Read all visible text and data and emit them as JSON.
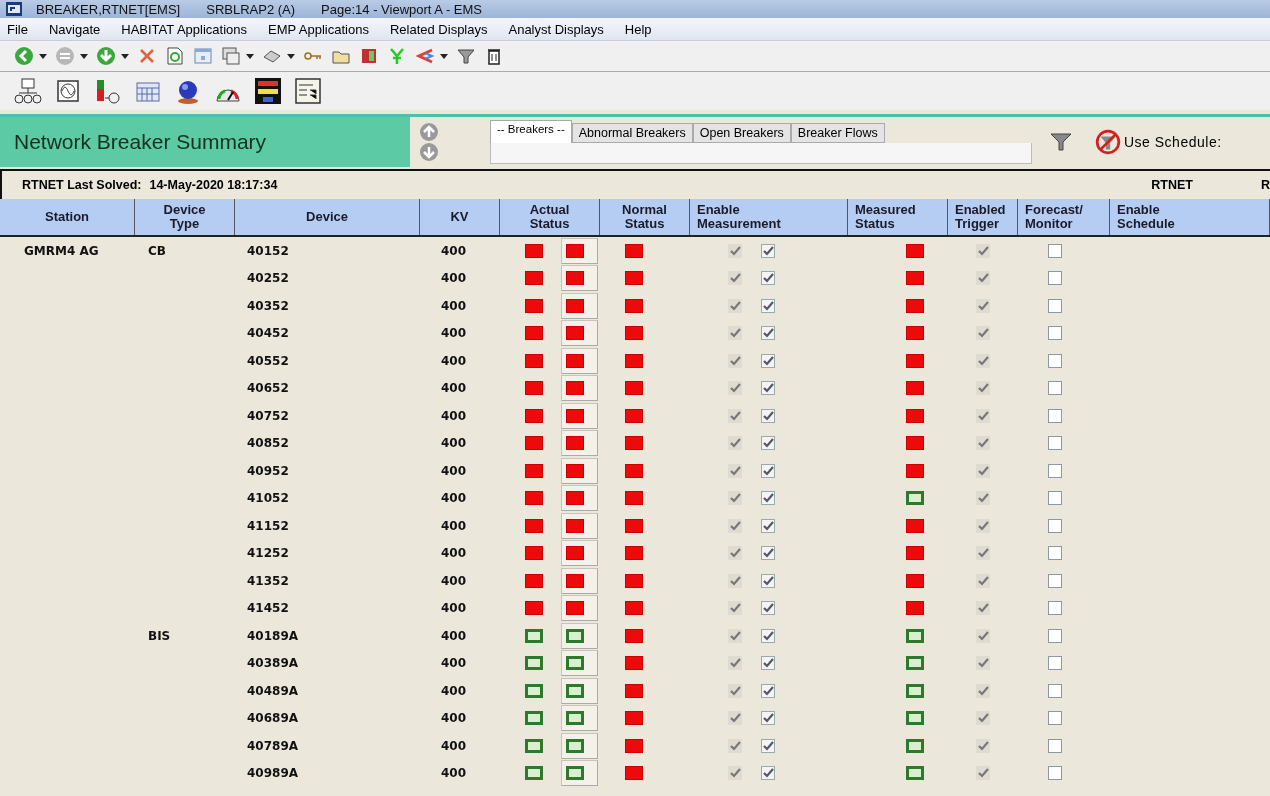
{
  "window": {
    "title_parts": [
      "BREAKER,RTNET[EMS]",
      "SRBLRAP2 (A)",
      "Page:14  - Viewport A - EMS"
    ]
  },
  "menu": [
    "File",
    "Navigate",
    "HABITAT Applications",
    "EMP Applications",
    "Related Displays",
    "Analyst Displays",
    "Help"
  ],
  "header": {
    "title": "Network Breaker Summary",
    "use_schedule": "Use Schedule:"
  },
  "tabs": [
    {
      "label": "-- Breakers --",
      "selected": true
    },
    {
      "label": "Abnormal Breakers",
      "selected": false
    },
    {
      "label": "Open Breakers",
      "selected": false
    },
    {
      "label": "Breaker Flows",
      "selected": false
    }
  ],
  "status_line": {
    "label": "RTNET Last Solved:",
    "time": "14-May-2020 18:17:34",
    "right": [
      "RTNET",
      "R"
    ]
  },
  "table": {
    "columns": [
      "Station",
      "Device Type",
      "Device",
      "KV",
      "Actual Status",
      "Normal Status",
      "Enable Measurement",
      "Measured Status",
      "Enabled Trigger",
      "Forecast/ Monitor",
      "Enable Schedule"
    ],
    "rows": [
      {
        "station": "GMRM4  AG",
        "device_type": "CB",
        "device": "40152",
        "kv": "400",
        "actual_closed": [
          true,
          true
        ],
        "normal_closed": true,
        "measurement": [
          true,
          true
        ],
        "measured_closed": true,
        "trigger": true,
        "forecast": false
      },
      {
        "device": "40252",
        "kv": "400",
        "actual_closed": [
          true,
          true
        ],
        "normal_closed": true,
        "measurement": [
          true,
          true
        ],
        "measured_closed": true,
        "trigger": true,
        "forecast": false
      },
      {
        "device": "40352",
        "kv": "400",
        "actual_closed": [
          true,
          true
        ],
        "normal_closed": true,
        "measurement": [
          true,
          true
        ],
        "measured_closed": true,
        "trigger": true,
        "forecast": false
      },
      {
        "device": "40452",
        "kv": "400",
        "actual_closed": [
          true,
          true
        ],
        "normal_closed": true,
        "measurement": [
          true,
          true
        ],
        "measured_closed": true,
        "trigger": true,
        "forecast": false
      },
      {
        "device": "40552",
        "kv": "400",
        "actual_closed": [
          true,
          true
        ],
        "normal_closed": true,
        "measurement": [
          true,
          true
        ],
        "measured_closed": true,
        "trigger": true,
        "forecast": false
      },
      {
        "device": "40652",
        "kv": "400",
        "actual_closed": [
          true,
          true
        ],
        "normal_closed": true,
        "measurement": [
          true,
          true
        ],
        "measured_closed": true,
        "trigger": true,
        "forecast": false
      },
      {
        "device": "40752",
        "kv": "400",
        "actual_closed": [
          true,
          true
        ],
        "normal_closed": true,
        "measurement": [
          true,
          true
        ],
        "measured_closed": true,
        "trigger": true,
        "forecast": false
      },
      {
        "device": "40852",
        "kv": "400",
        "actual_closed": [
          true,
          true
        ],
        "normal_closed": true,
        "measurement": [
          true,
          true
        ],
        "measured_closed": true,
        "trigger": true,
        "forecast": false
      },
      {
        "device": "40952",
        "kv": "400",
        "actual_closed": [
          true,
          true
        ],
        "normal_closed": true,
        "measurement": [
          true,
          true
        ],
        "measured_closed": true,
        "trigger": true,
        "forecast": false
      },
      {
        "device": "41052",
        "kv": "400",
        "actual_closed": [
          true,
          true
        ],
        "normal_closed": true,
        "measurement": [
          true,
          true
        ],
        "measured_closed": false,
        "trigger": true,
        "forecast": false
      },
      {
        "device": "41152",
        "kv": "400",
        "actual_closed": [
          true,
          true
        ],
        "normal_closed": true,
        "measurement": [
          true,
          true
        ],
        "measured_closed": true,
        "trigger": true,
        "forecast": false
      },
      {
        "device": "41252",
        "kv": "400",
        "actual_closed": [
          true,
          true
        ],
        "normal_closed": true,
        "measurement": [
          true,
          true
        ],
        "measured_closed": true,
        "trigger": true,
        "forecast": false
      },
      {
        "device": "41352",
        "kv": "400",
        "actual_closed": [
          true,
          true
        ],
        "normal_closed": true,
        "measurement": [
          true,
          true
        ],
        "measured_closed": true,
        "trigger": true,
        "forecast": false
      },
      {
        "device": "41452",
        "kv": "400",
        "actual_closed": [
          true,
          true
        ],
        "normal_closed": true,
        "measurement": [
          true,
          true
        ],
        "measured_closed": true,
        "trigger": true,
        "forecast": false
      },
      {
        "device_type": "BIS",
        "device": "40189A",
        "kv": "400",
        "actual_closed": [
          false,
          false
        ],
        "normal_closed": true,
        "measurement": [
          true,
          true
        ],
        "measured_closed": false,
        "trigger": true,
        "forecast": false
      },
      {
        "device": "40389A",
        "kv": "400",
        "actual_closed": [
          false,
          false
        ],
        "normal_closed": true,
        "measurement": [
          true,
          true
        ],
        "measured_closed": false,
        "trigger": true,
        "forecast": false
      },
      {
        "device": "40489A",
        "kv": "400",
        "actual_closed": [
          false,
          false
        ],
        "normal_closed": true,
        "measurement": [
          true,
          true
        ],
        "measured_closed": false,
        "trigger": true,
        "forecast": false
      },
      {
        "device": "40689A",
        "kv": "400",
        "actual_closed": [
          false,
          false
        ],
        "normal_closed": true,
        "measurement": [
          true,
          true
        ],
        "measured_closed": false,
        "trigger": true,
        "forecast": false
      },
      {
        "device": "40789A",
        "kv": "400",
        "actual_closed": [
          false,
          false
        ],
        "normal_closed": true,
        "measurement": [
          true,
          true
        ],
        "measured_closed": false,
        "trigger": true,
        "forecast": false
      },
      {
        "device": "40989A",
        "kv": "400",
        "actual_closed": [
          false,
          false
        ],
        "normal_closed": true,
        "measurement": [
          true,
          true
        ],
        "measured_closed": false,
        "trigger": true,
        "forecast": false
      }
    ]
  }
}
